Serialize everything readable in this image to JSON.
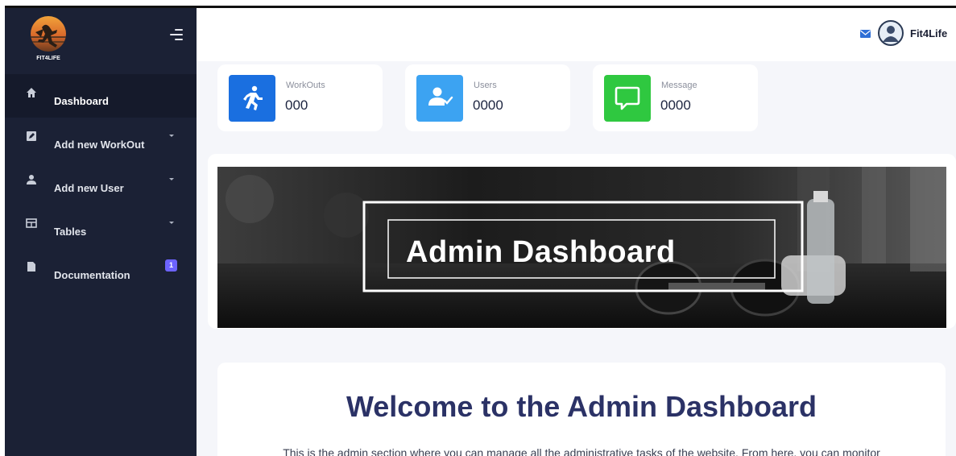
{
  "sidebar": {
    "logo_text": "FIT4LIFE",
    "items": [
      {
        "label": "Dashboard",
        "icon": "home-icon",
        "active": true
      },
      {
        "label": "Add new WorkOut",
        "icon": "edit-icon",
        "has_submenu": true
      },
      {
        "label": "Add new User",
        "icon": "user-icon",
        "has_submenu": true
      },
      {
        "label": "Tables",
        "icon": "table-icon",
        "has_submenu": true
      },
      {
        "label": "Documentation",
        "icon": "document-icon",
        "badge": "1"
      }
    ]
  },
  "topbar": {
    "brand_name": "Fit4Life",
    "icons": [
      "mail-icon",
      "avatar"
    ]
  },
  "stats": [
    {
      "label": "WorkOuts",
      "value": "000",
      "icon": "running-icon",
      "color": "#1a6fe0"
    },
    {
      "label": "Users",
      "value": "0000",
      "icon": "user-check-icon",
      "color": "#3ca3f2"
    },
    {
      "label": "Message",
      "value": "0000",
      "icon": "message-icon",
      "color": "#2fc840"
    }
  ],
  "banner": {
    "title": "Admin Dashboard"
  },
  "welcome": {
    "title": "Welcome to the Admin Dashboard",
    "text": "This is the admin section where you can manage all the administrative tasks of the website. From here, you can monitor"
  },
  "colors": {
    "sidebar_bg": "#1b2135",
    "sidebar_active": "#151a2b",
    "badge": "#6c63ff",
    "heading": "#2b3266",
    "page_bg": "#f5f6fa"
  }
}
